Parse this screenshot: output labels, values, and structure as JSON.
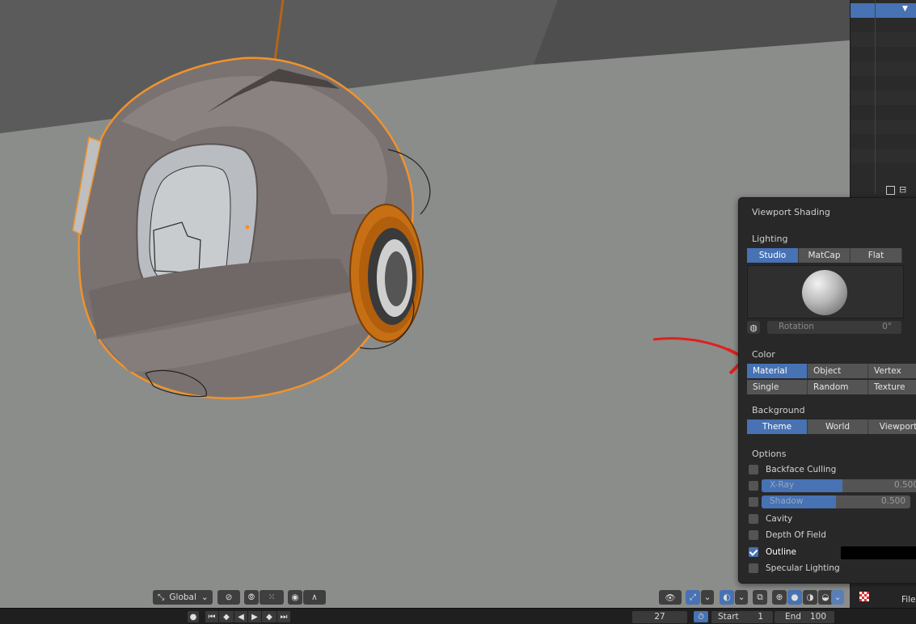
{
  "viewport": {
    "toolbar": {
      "orientation_label": "Global"
    }
  },
  "shading": {
    "title": "Viewport Shading",
    "lighting": {
      "heading": "Lighting",
      "options": [
        "Studio",
        "MatCap",
        "Flat"
      ],
      "selected": "Studio",
      "rotation_label": "Rotation",
      "rotation_value": "0°"
    },
    "color": {
      "heading": "Color",
      "row1": [
        "Material",
        "Object",
        "Vertex"
      ],
      "row2": [
        "Single",
        "Random",
        "Texture"
      ],
      "selected": "Material"
    },
    "background": {
      "heading": "Background",
      "options": [
        "Theme",
        "World",
        "Viewport"
      ],
      "selected": "Theme"
    },
    "options": {
      "heading": "Options",
      "backface_culling": "Backface Culling",
      "xray_label": "X-Ray",
      "xray_value": "0.500",
      "xray_fraction": 0.5,
      "shadow_label": "Shadow",
      "shadow_value": "0.500",
      "shadow_fraction": 0.5,
      "cavity": "Cavity",
      "depth_of_field": "Depth Of Field",
      "outline": "Outline",
      "outline_checked": true,
      "specular_lighting": "Specular Lighting"
    }
  },
  "timeline": {
    "current_frame": "27",
    "start_label": "Start",
    "start_value": "1",
    "end_label": "End",
    "end_value": "100"
  },
  "file_label": "File",
  "colors": {
    "accent": "#4772b3",
    "selection_outline": "#f0932b",
    "annotation_arrow": "#e0201c"
  }
}
